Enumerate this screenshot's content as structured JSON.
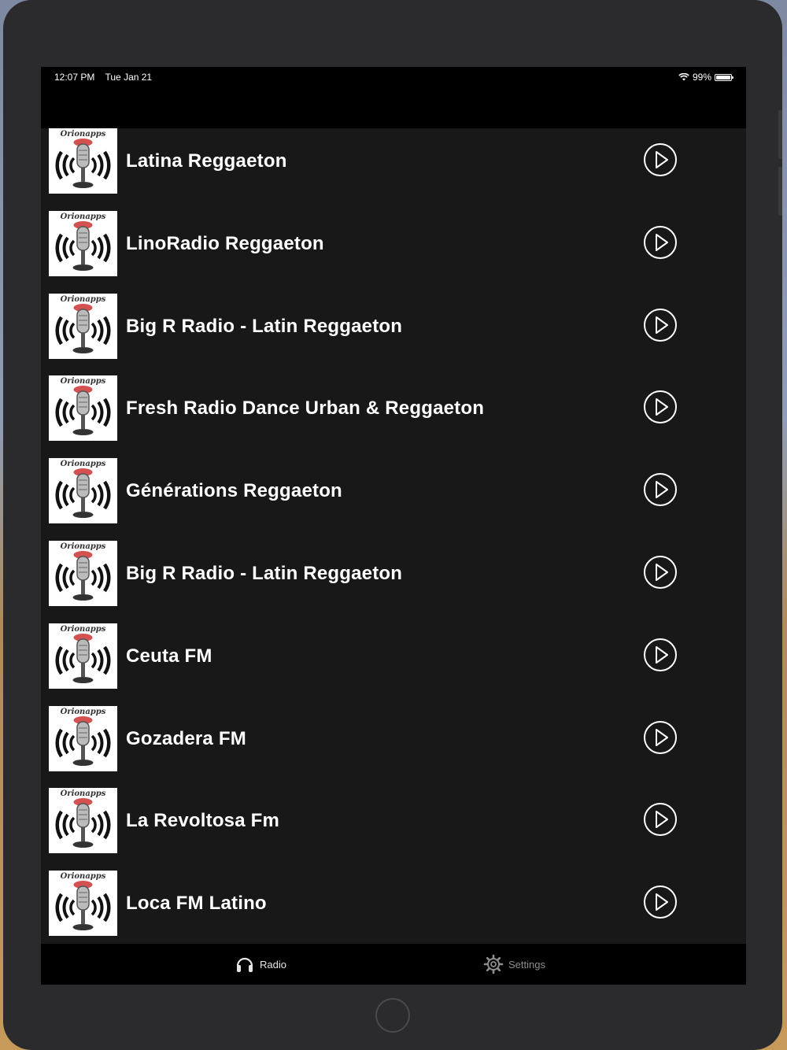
{
  "status_bar": {
    "time": "12:07 PM",
    "date": "Tue Jan 21",
    "battery": "99%"
  },
  "stations": [
    {
      "name": "Latina Reggaeton",
      "logo_text": "Orionapps"
    },
    {
      "name": "LinoRadio Reggaeton",
      "logo_text": "Orionapps"
    },
    {
      "name": "Big R Radio - Latin Reggaeton",
      "logo_text": "Orionapps"
    },
    {
      "name": "Fresh Radio Dance Urban & Reggaeton",
      "logo_text": "Orionapps"
    },
    {
      "name": "Générations Reggaeton",
      "logo_text": "Orionapps"
    },
    {
      "name": "Big R Radio - Latin Reggaeton",
      "logo_text": "Orionapps"
    },
    {
      "name": "Ceuta FM",
      "logo_text": "Orionapps"
    },
    {
      "name": "Gozadera FM",
      "logo_text": "Orionapps"
    },
    {
      "name": "La Revoltosa Fm",
      "logo_text": "Orionapps"
    },
    {
      "name": "Loca FM Latino",
      "logo_text": "Orionapps"
    }
  ],
  "tabs": {
    "radio": {
      "label": "Radio",
      "icon": "headphones-icon",
      "active": true
    },
    "settings": {
      "label": "Settings",
      "icon": "gear-icon",
      "active": false
    }
  },
  "colors": {
    "list_background": "#181818",
    "bar_background": "#000000",
    "text": "#ffffff",
    "inactive_tab": "#8e8e8e"
  }
}
